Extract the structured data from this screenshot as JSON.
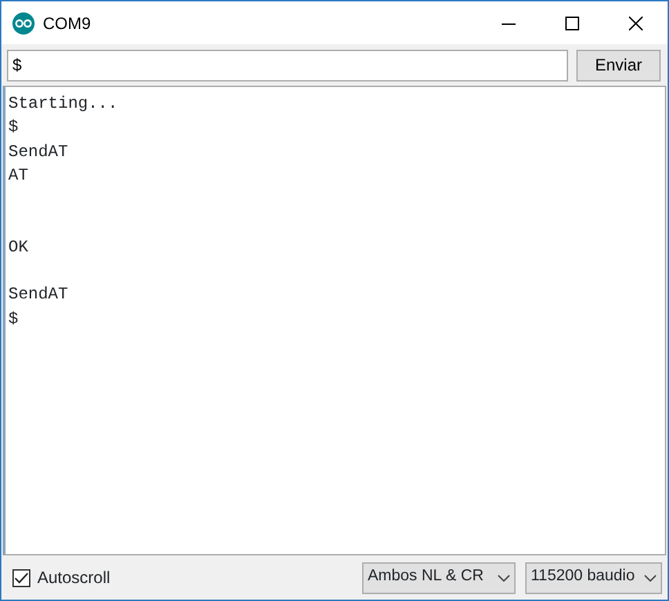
{
  "window": {
    "title": "COM9"
  },
  "send": {
    "value": "$",
    "button": "Enviar"
  },
  "output": [
    {
      "kind": "text",
      "text": "Starting..."
    },
    {
      "kind": "text",
      "text": "$"
    },
    {
      "kind": "text",
      "text": "SendAT"
    },
    {
      "kind": "text",
      "text": "AT"
    },
    {
      "kind": "blank"
    },
    {
      "kind": "blank"
    },
    {
      "kind": "text",
      "text": "OK"
    },
    {
      "kind": "blank"
    },
    {
      "kind": "text",
      "text": "SendAT"
    },
    {
      "kind": "text",
      "text": "$"
    }
  ],
  "footer": {
    "autoscroll": {
      "label": "Autoscroll",
      "checked": true
    },
    "line_ending": "Ambos NL & CR",
    "baud": "115200 baudio"
  }
}
